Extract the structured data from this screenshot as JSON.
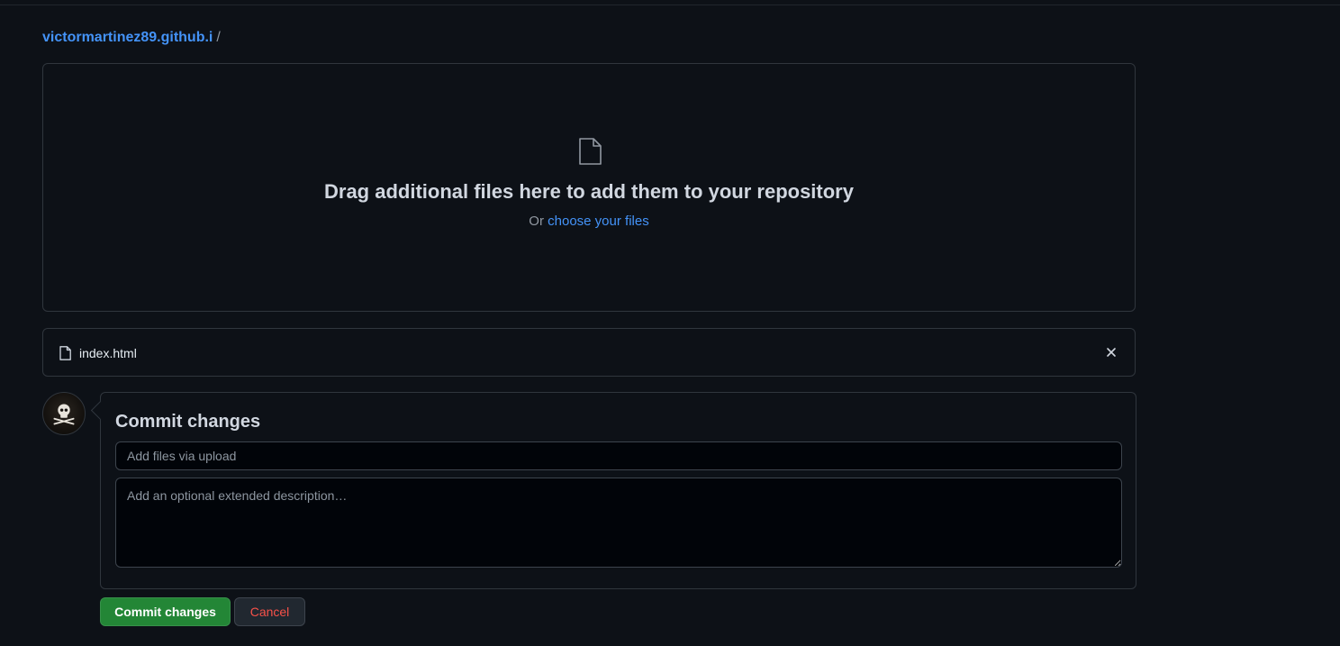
{
  "breadcrumb": {
    "repo": "victormartinez89.github.i",
    "separator": "/"
  },
  "dropzone": {
    "icon": "file-icon",
    "headline": "Drag additional files here to add them to your repository",
    "or_text": "Or ",
    "choose_link": "choose your files"
  },
  "files": [
    {
      "name": "index.html",
      "icon": "file-icon",
      "remove_icon": "close-icon"
    }
  ],
  "commit": {
    "title": "Commit changes",
    "summary_placeholder": "Add files via upload",
    "description_placeholder": "Add an optional extended description…",
    "submit_label": "Commit changes",
    "cancel_label": "Cancel"
  },
  "colors": {
    "background": "#0d1117",
    "link": "#4493f8",
    "primary_button": "#238636",
    "danger_text": "#f85149",
    "border": "#30363d"
  }
}
